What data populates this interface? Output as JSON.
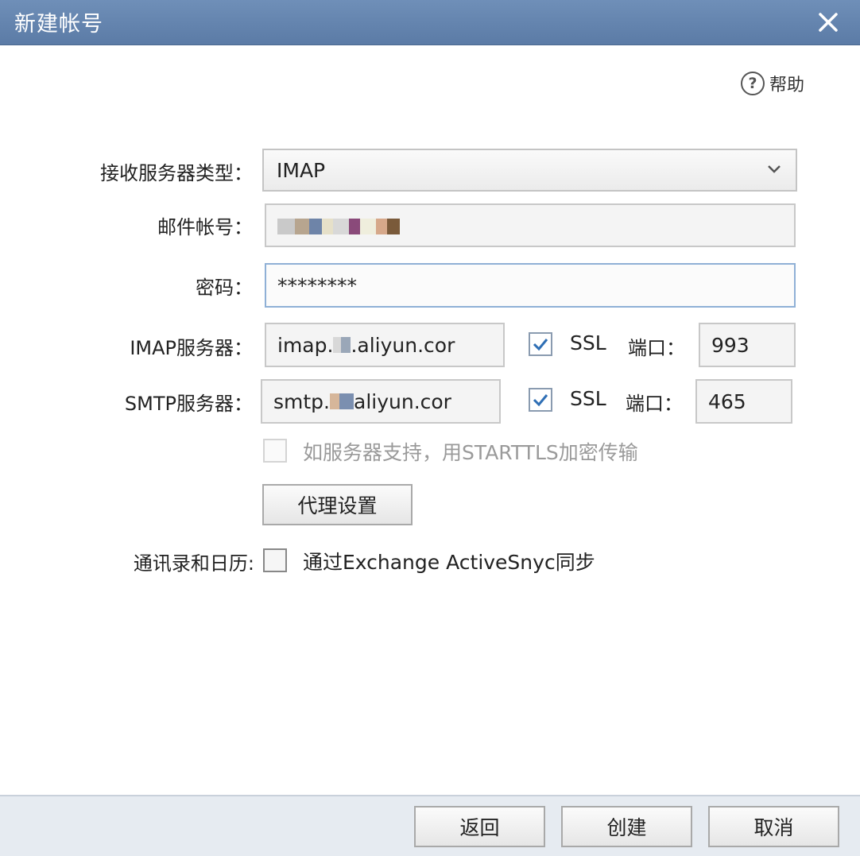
{
  "window": {
    "title": "新建帐号",
    "close_icon": "close-icon"
  },
  "help": {
    "icon": "question-circle-icon",
    "label": "帮助"
  },
  "form": {
    "server_type": {
      "label": "接收服务器类型：",
      "value": "IMAP",
      "icon": "chevron-down-icon"
    },
    "account": {
      "label": "邮件帐号：",
      "value": ""
    },
    "password": {
      "label": "密码：",
      "value": "********"
    },
    "imap": {
      "label": "IMAP服务器：",
      "value_prefix": "imap.",
      "value_suffix": ".aliyun.cor",
      "ssl_label": "SSL",
      "ssl_checked": true,
      "port_label": "端口：",
      "port": "993"
    },
    "smtp": {
      "label": "SMTP服务器：",
      "value_prefix": "smtp.",
      "value_suffix": "aliyun.cor",
      "ssl_label": "SSL",
      "ssl_checked": true,
      "port_label": "端口：",
      "port": "465"
    },
    "starttls": {
      "label": "如服务器支持，用STARTTLS加密传输",
      "checked": false,
      "enabled": false
    },
    "proxy_button": "代理设置",
    "sync": {
      "label": "通讯录和日历:",
      "option_label": "通过Exchange ActiveSnyc同步",
      "checked": false
    }
  },
  "footer": {
    "back": "返回",
    "create": "创建",
    "cancel": "取消"
  },
  "colors": {
    "titlebar": "#5b7ba6",
    "check": "#2f6fb5",
    "focus_border": "#8fb0d6"
  }
}
